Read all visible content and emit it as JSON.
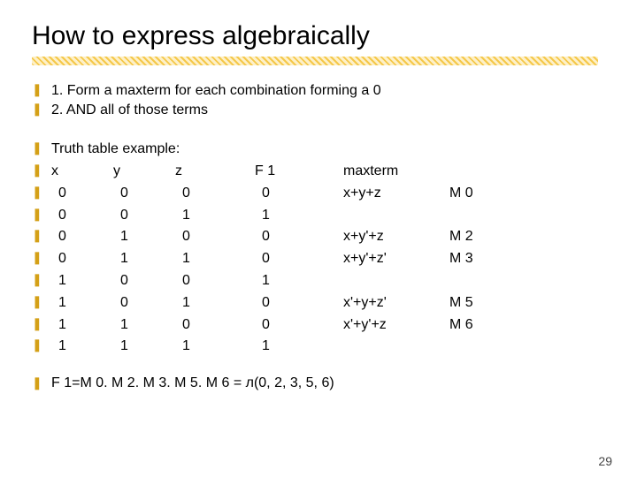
{
  "title": "How to express algebraically",
  "bullets_a": [
    "1. Form a maxterm for each combination forming a 0",
    "2. AND all of those terms"
  ],
  "table": {
    "intro": "Truth table example:",
    "headers": {
      "x": "x",
      "y": "y",
      "z": "z",
      "f1": "F 1",
      "maxterm": "maxterm"
    },
    "rows": [
      {
        "x": "0",
        "y": "0",
        "z": "0",
        "f1": "0",
        "maxterm": "x+y+z",
        "m": "M 0"
      },
      {
        "x": "0",
        "y": "0",
        "z": "1",
        "f1": "1",
        "maxterm": "",
        "m": ""
      },
      {
        "x": "0",
        "y": "1",
        "z": "0",
        "f1": "0",
        "maxterm": "x+y'+z",
        "m": "M 2"
      },
      {
        "x": "0",
        "y": "1",
        "z": "1",
        "f1": "0",
        "maxterm": "x+y'+z'",
        "m": "M 3"
      },
      {
        "x": "1",
        "y": "0",
        "z": "0",
        "f1": "1",
        "maxterm": "",
        "m": ""
      },
      {
        "x": "1",
        "y": "0",
        "z": "1",
        "f1": "0",
        "maxterm": "x'+y+z'",
        "m": "M 5"
      },
      {
        "x": "1",
        "y": "1",
        "z": "0",
        "f1": "0",
        "maxterm": "x'+y'+z",
        "m": "M 6"
      },
      {
        "x": "1",
        "y": "1",
        "z": "1",
        "f1": "1",
        "maxterm": "",
        "m": ""
      }
    ]
  },
  "final": "F 1=M 0. M 2. M 3. M 5. M 6 = л(0, 2, 3, 5, 6)",
  "bullet_glyph": "❚",
  "page_number": "29",
  "chart_data": {
    "type": "table",
    "title": "Truth table example",
    "columns": [
      "x",
      "y",
      "z",
      "F1",
      "maxterm",
      "M"
    ],
    "rows": [
      [
        0,
        0,
        0,
        0,
        "x+y+z",
        "M0"
      ],
      [
        0,
        0,
        1,
        1,
        "",
        ""
      ],
      [
        0,
        1,
        0,
        0,
        "x+y'+z",
        "M2"
      ],
      [
        0,
        1,
        1,
        0,
        "x+y'+z'",
        "M3"
      ],
      [
        1,
        0,
        0,
        1,
        "",
        ""
      ],
      [
        1,
        0,
        1,
        0,
        "x'+y+z'",
        "M5"
      ],
      [
        1,
        1,
        0,
        0,
        "x'+y'+z",
        "M6"
      ],
      [
        1,
        1,
        1,
        1,
        "",
        ""
      ]
    ]
  }
}
